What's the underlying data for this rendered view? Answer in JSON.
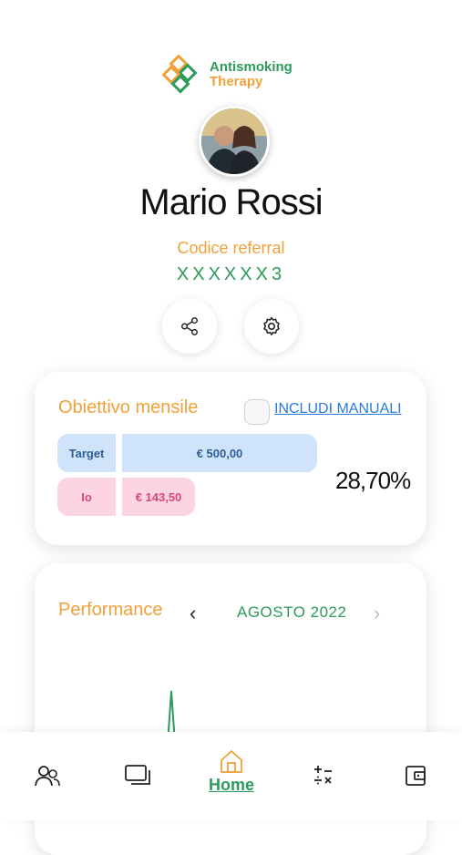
{
  "logo": {
    "line1": "Antismoking",
    "line2": "Therapy"
  },
  "profile": {
    "name": "Mario Rossi",
    "referral_label": "Codice referral",
    "referral_code": "XXXXXX3"
  },
  "objective": {
    "title": "Obiettivo mensile",
    "include_manual_label": "INCLUDI MANUALI",
    "include_manual_checked": false,
    "target_label": "Target",
    "target_value": "€ 500,00",
    "me_label": "Io",
    "me_value": "€ 143,50",
    "progress_percent_text": "28,70%",
    "progress_fraction": 0.287
  },
  "performance": {
    "title": "Performance",
    "month": "AGOSTO 2022",
    "prev_icon": "chevron-left-icon",
    "next_icon": "chevron-right-icon"
  },
  "nav": {
    "items": [
      {
        "icon": "users-icon"
      },
      {
        "icon": "chat-icon"
      },
      {
        "icon": "home-icon",
        "label": "Home",
        "active": true
      },
      {
        "icon": "calculator-icon"
      },
      {
        "icon": "wallet-icon"
      }
    ]
  },
  "colors": {
    "green": "#2e9a5a",
    "orange": "#f0a13a",
    "blue": "#cfe3fb",
    "pink": "#fdd4e2",
    "link": "#2a7bd8"
  }
}
